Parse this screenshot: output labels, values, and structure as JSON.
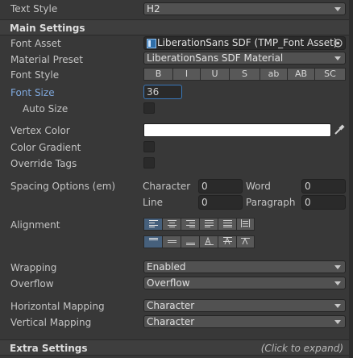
{
  "text_style": {
    "label": "Text Style",
    "value": "H2"
  },
  "main_settings": {
    "title": "Main Settings"
  },
  "font_asset": {
    "label": "Font Asset",
    "value": "LiberationSans SDF (TMP_Font Asset)"
  },
  "material_preset": {
    "label": "Material Preset",
    "value": "LiberationSans SDF Material"
  },
  "font_style": {
    "label": "Font Style",
    "buttons": [
      "B",
      "I",
      "U",
      "S",
      "ab",
      "AB",
      "SC"
    ]
  },
  "font_size": {
    "label": "Font Size",
    "value": "36"
  },
  "auto_size": {
    "label": "Auto Size"
  },
  "vertex_color": {
    "label": "Vertex Color",
    "color": "#ffffff"
  },
  "color_gradient": {
    "label": "Color Gradient"
  },
  "override_tags": {
    "label": "Override Tags"
  },
  "spacing": {
    "label": "Spacing Options (em)",
    "character": {
      "label": "Character",
      "value": "0"
    },
    "word": {
      "label": "Word",
      "value": "0"
    },
    "line": {
      "label": "Line",
      "value": "0"
    },
    "paragraph": {
      "label": "Paragraph",
      "value": "0"
    }
  },
  "alignment": {
    "label": "Alignment"
  },
  "wrapping": {
    "label": "Wrapping",
    "value": "Enabled"
  },
  "overflow": {
    "label": "Overflow",
    "value": "Overflow"
  },
  "horizontal_mapping": {
    "label": "Horizontal Mapping",
    "value": "Character"
  },
  "vertical_mapping": {
    "label": "Vertical Mapping",
    "value": "Character"
  },
  "extra_settings": {
    "title": "Extra Settings",
    "hint": "(Click to expand)"
  },
  "colors": {
    "accent": "#46607c",
    "font_size_label": "#7fa8dc",
    "background": "#383838"
  }
}
